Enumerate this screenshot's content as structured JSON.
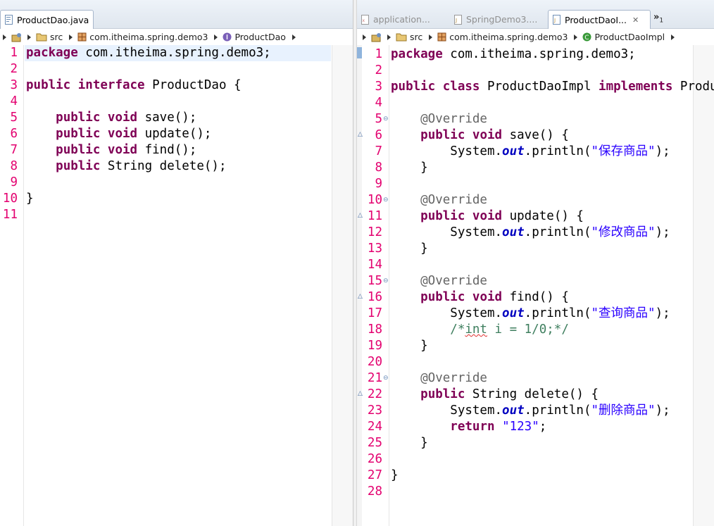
{
  "left": {
    "tab": {
      "label": "ProductDao.java"
    },
    "breadcrumb": {
      "src": "src",
      "pkg": "com.itheima.spring.demo3",
      "type": "ProductDao"
    },
    "lines": [
      {
        "n": "1",
        "t": [
          [
            "kw",
            "package"
          ],
          [
            "pl",
            " com.itheima.spring.demo3;"
          ]
        ]
      },
      {
        "n": "2",
        "t": []
      },
      {
        "n": "3",
        "t": [
          [
            "kw",
            "public"
          ],
          [
            "pl",
            " "
          ],
          [
            "kw",
            "interface"
          ],
          [
            "pl",
            " ProductDao {"
          ]
        ]
      },
      {
        "n": "4",
        "t": []
      },
      {
        "n": "5",
        "t": [
          [
            "pl",
            "    "
          ],
          [
            "kw",
            "public"
          ],
          [
            "pl",
            " "
          ],
          [
            "kw",
            "void"
          ],
          [
            "pl",
            " save();"
          ]
        ]
      },
      {
        "n": "6",
        "t": [
          [
            "pl",
            "    "
          ],
          [
            "kw",
            "public"
          ],
          [
            "pl",
            " "
          ],
          [
            "kw",
            "void"
          ],
          [
            "pl",
            " update();"
          ]
        ]
      },
      {
        "n": "7",
        "t": [
          [
            "pl",
            "    "
          ],
          [
            "kw",
            "public"
          ],
          [
            "pl",
            " "
          ],
          [
            "kw",
            "void"
          ],
          [
            "pl",
            " find();"
          ]
        ]
      },
      {
        "n": "8",
        "t": [
          [
            "pl",
            "    "
          ],
          [
            "kw",
            "public"
          ],
          [
            "pl",
            " String delete();"
          ]
        ]
      },
      {
        "n": "9",
        "t": []
      },
      {
        "n": "10",
        "t": [
          [
            "pl",
            "}"
          ]
        ]
      },
      {
        "n": "11",
        "t": []
      }
    ]
  },
  "right": {
    "tabs": [
      {
        "label": "application...",
        "active": false
      },
      {
        "label": "SpringDemo3....",
        "active": false
      },
      {
        "label": "ProductDaoI...",
        "active": true
      }
    ],
    "overflow": {
      "symbol": "»",
      "count": "1"
    },
    "breadcrumb": {
      "src": "src",
      "pkg": "com.itheima.spring.demo3",
      "type": "ProductDaoImpl"
    },
    "lines": [
      {
        "n": "1",
        "t": [
          [
            "kw",
            "package"
          ],
          [
            "pl",
            " com.itheima.spring.demo3;"
          ]
        ]
      },
      {
        "n": "2",
        "t": []
      },
      {
        "n": "3",
        "t": [
          [
            "kw",
            "public"
          ],
          [
            "pl",
            " "
          ],
          [
            "kw",
            "class"
          ],
          [
            "pl",
            " ProductDaoImpl "
          ],
          [
            "kw",
            "implements"
          ],
          [
            "pl",
            " ProductDao {"
          ]
        ]
      },
      {
        "n": "4",
        "t": []
      },
      {
        "n": "5",
        "fold": true,
        "t": [
          [
            "ann",
            "    @Override"
          ]
        ]
      },
      {
        "n": "6",
        "override": true,
        "t": [
          [
            "pl",
            "    "
          ],
          [
            "kw",
            "public"
          ],
          [
            "pl",
            " "
          ],
          [
            "kw",
            "void"
          ],
          [
            "pl",
            " save() {"
          ]
        ]
      },
      {
        "n": "7",
        "t": [
          [
            "pl",
            "        System."
          ],
          [
            "fld",
            "out"
          ],
          [
            "pl",
            ".println("
          ],
          [
            "str",
            "\"保存商品\""
          ],
          [
            "pl",
            ");"
          ]
        ]
      },
      {
        "n": "8",
        "t": [
          [
            "pl",
            "    }"
          ]
        ]
      },
      {
        "n": "9",
        "t": []
      },
      {
        "n": "10",
        "fold": true,
        "t": [
          [
            "ann",
            "    @Override"
          ]
        ]
      },
      {
        "n": "11",
        "override": true,
        "t": [
          [
            "pl",
            "    "
          ],
          [
            "kw",
            "public"
          ],
          [
            "pl",
            " "
          ],
          [
            "kw",
            "void"
          ],
          [
            "pl",
            " update() {"
          ]
        ]
      },
      {
        "n": "12",
        "t": [
          [
            "pl",
            "        System."
          ],
          [
            "fld",
            "out"
          ],
          [
            "pl",
            ".println("
          ],
          [
            "str",
            "\"修改商品\""
          ],
          [
            "pl",
            ");"
          ]
        ]
      },
      {
        "n": "13",
        "t": [
          [
            "pl",
            "    }"
          ]
        ]
      },
      {
        "n": "14",
        "t": []
      },
      {
        "n": "15",
        "fold": true,
        "t": [
          [
            "ann",
            "    @Override"
          ]
        ]
      },
      {
        "n": "16",
        "override": true,
        "t": [
          [
            "pl",
            "    "
          ],
          [
            "kw",
            "public"
          ],
          [
            "pl",
            " "
          ],
          [
            "kw",
            "void"
          ],
          [
            "pl",
            " find() {"
          ]
        ]
      },
      {
        "n": "17",
        "t": [
          [
            "pl",
            "        System."
          ],
          [
            "fld",
            "out"
          ],
          [
            "pl",
            ".println("
          ],
          [
            "str",
            "\"查询商品\""
          ],
          [
            "pl",
            ");"
          ]
        ]
      },
      {
        "n": "18",
        "t": [
          [
            "cmt",
            "        /*"
          ],
          [
            "cmtsq",
            "int"
          ],
          [
            "cmt",
            " i = 1/0;*/"
          ]
        ]
      },
      {
        "n": "19",
        "t": [
          [
            "pl",
            "    }"
          ]
        ]
      },
      {
        "n": "20",
        "t": []
      },
      {
        "n": "21",
        "fold": true,
        "t": [
          [
            "ann",
            "    @Override"
          ]
        ]
      },
      {
        "n": "22",
        "override": true,
        "t": [
          [
            "pl",
            "    "
          ],
          [
            "kw",
            "public"
          ],
          [
            "pl",
            " String delete() {"
          ]
        ]
      },
      {
        "n": "23",
        "t": [
          [
            "pl",
            "        System."
          ],
          [
            "fld",
            "out"
          ],
          [
            "pl",
            ".println("
          ],
          [
            "str",
            "\"删除商品\""
          ],
          [
            "pl",
            ");"
          ]
        ]
      },
      {
        "n": "24",
        "t": [
          [
            "pl",
            "        "
          ],
          [
            "kw",
            "return"
          ],
          [
            "pl",
            " "
          ],
          [
            "str",
            "\"123\""
          ],
          [
            "pl",
            ";"
          ]
        ]
      },
      {
        "n": "25",
        "t": [
          [
            "pl",
            "    }"
          ]
        ]
      },
      {
        "n": "26",
        "t": []
      },
      {
        "n": "27",
        "t": [
          [
            "pl",
            "}"
          ]
        ]
      },
      {
        "n": "28",
        "t": []
      }
    ]
  }
}
